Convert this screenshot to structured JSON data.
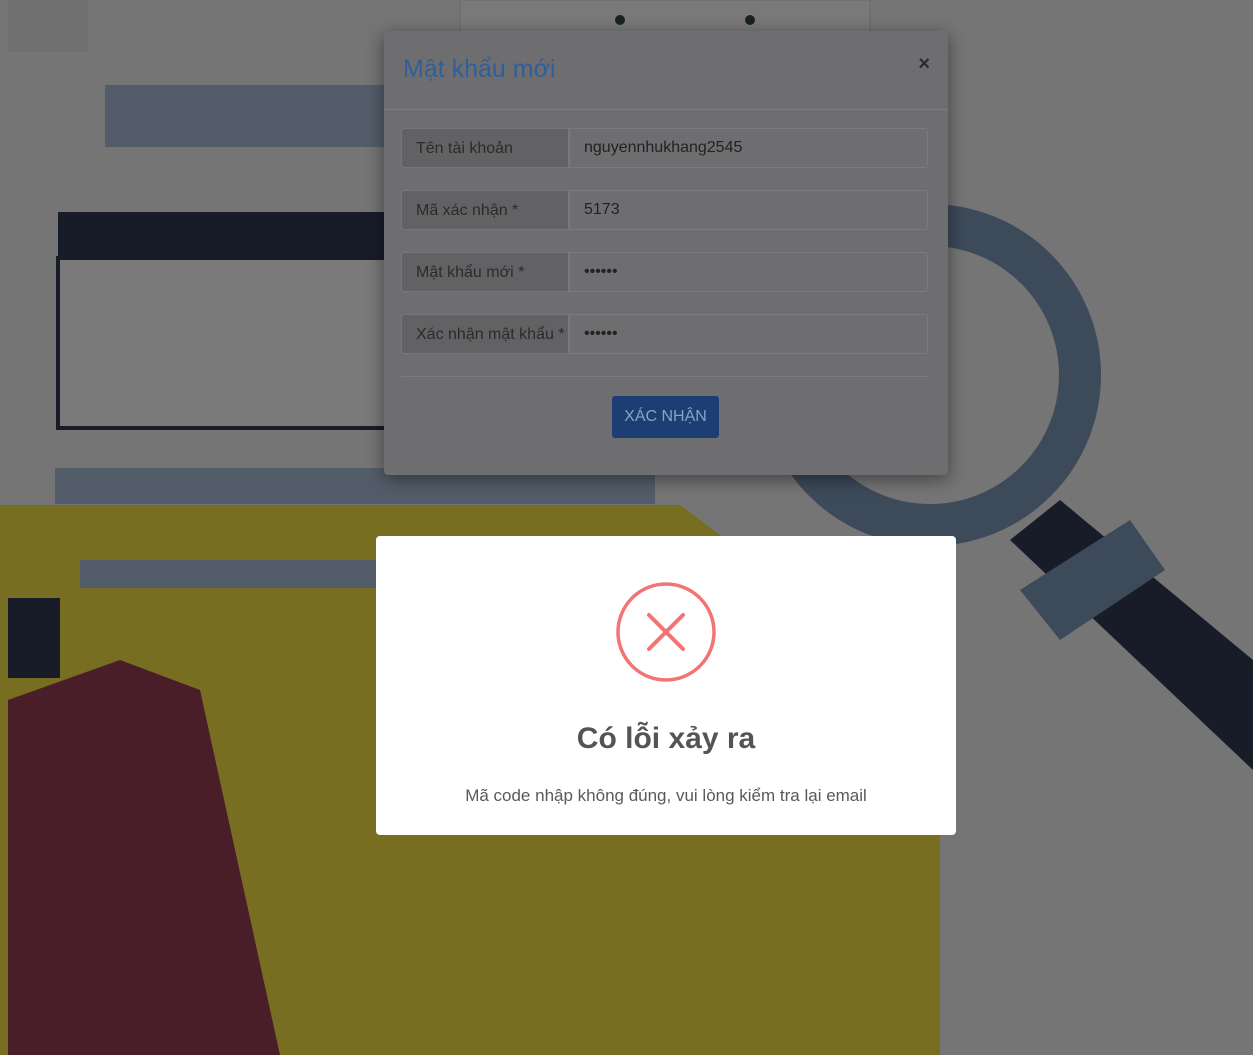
{
  "modal": {
    "title": "Mật khẩu mới",
    "close_label": "×",
    "fields": [
      {
        "label": "Tên tài khoản",
        "value": "nguyennhukhang2545"
      },
      {
        "label": "Mã xác nhận *",
        "value": "5173"
      },
      {
        "label": "Mật khẩu mới *",
        "value": "••••••"
      },
      {
        "label": "Xác nhận mật khẩu *",
        "value": "••••••"
      }
    ],
    "submit_label": "XÁC NHẬN"
  },
  "alert": {
    "icon": "error-x-icon",
    "title": "Có lỗi xảy ra",
    "message": "Mã code nhập không đúng, vui lòng kiểm tra lại email",
    "icon_color": "#f27474"
  },
  "colors": {
    "primary_button": "#0d6efd",
    "title_blue": "#1a73e8"
  }
}
